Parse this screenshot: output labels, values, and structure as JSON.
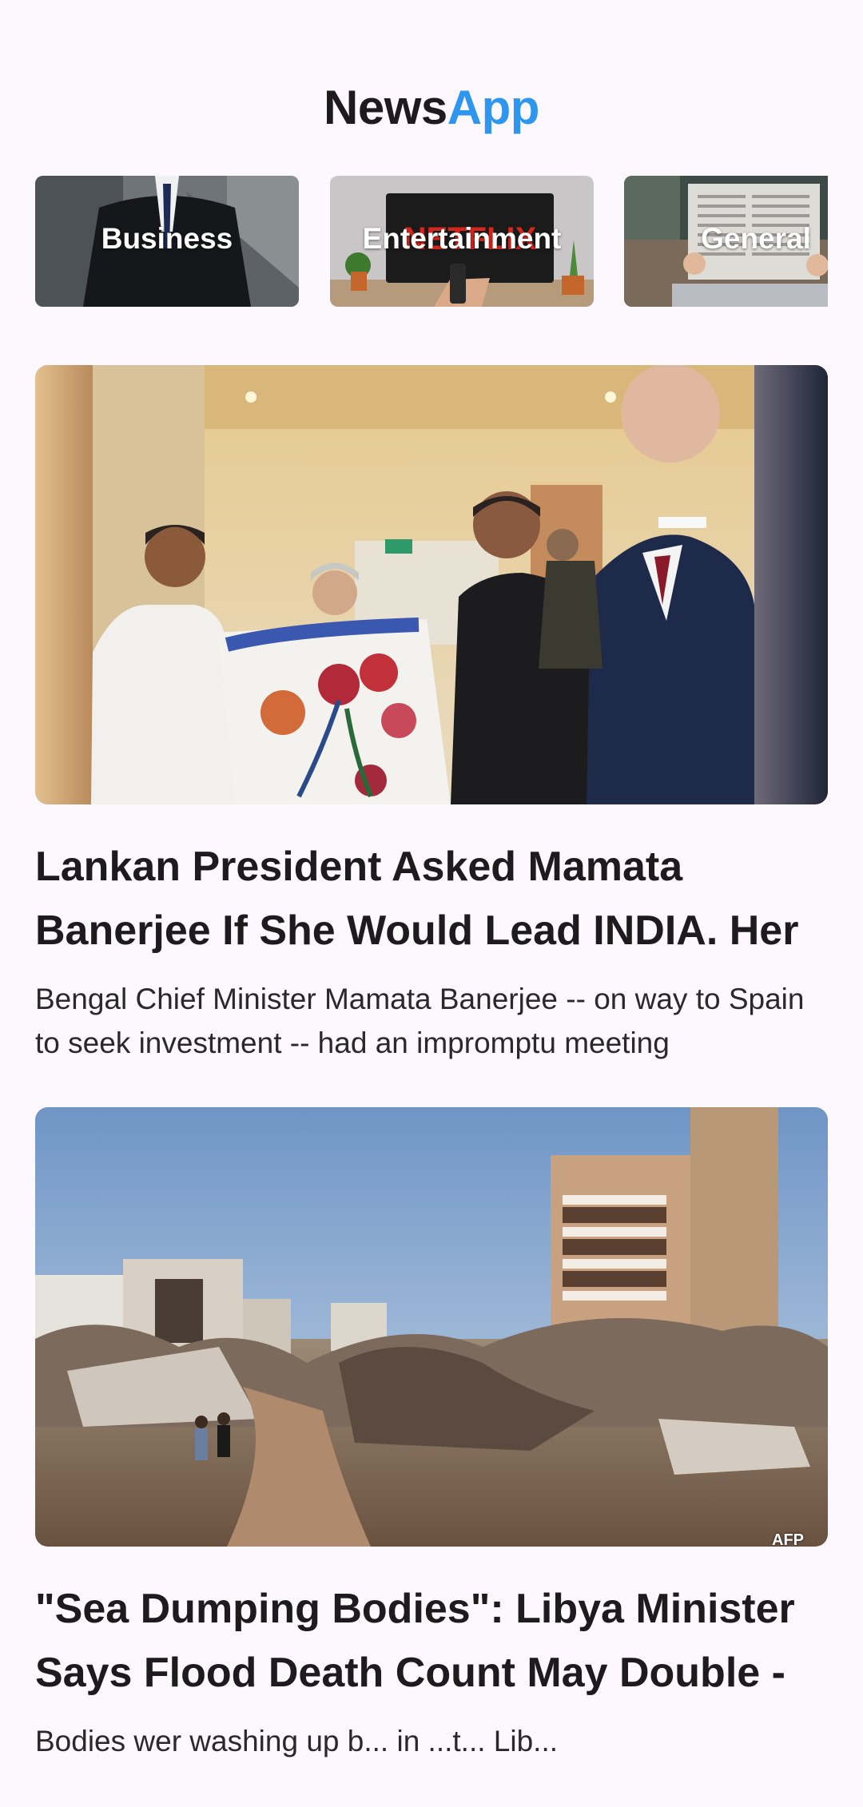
{
  "app": {
    "title_part1": "News",
    "title_part2": "App"
  },
  "categories": [
    {
      "label": "Business"
    },
    {
      "label": "Entertainment"
    },
    {
      "label": "General"
    }
  ],
  "articles": [
    {
      "title": "Lankan President Asked Mamata Banerjee If She Would Lead INDIA. Her",
      "description": "Bengal Chief Minister Mamata Banerjee -- on way to Spain to seek investment -- had an impromptu meeting"
    },
    {
      "title": "\"Sea Dumping Bodies\": Libya Minister Says Flood Death Count May Double -",
      "description": "Bodies wer washing up b... in ...t... Lib...",
      "image_credit": "AFP"
    }
  ],
  "colors": {
    "accent": "#2f96f0",
    "background": "#fdf8fd",
    "text": "#1e1b1e"
  }
}
